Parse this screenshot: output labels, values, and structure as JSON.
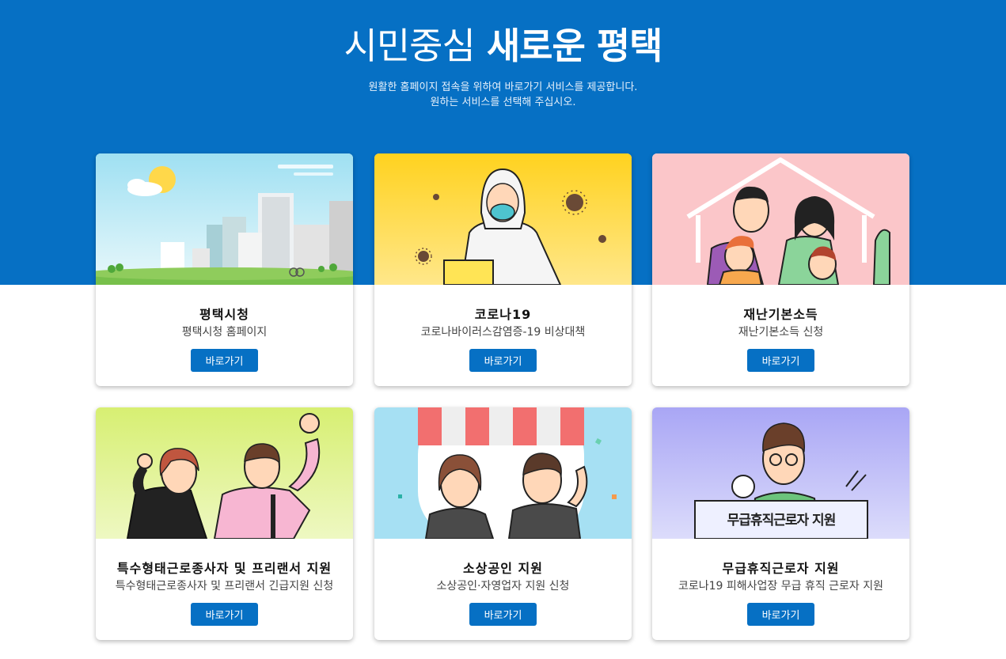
{
  "hero": {
    "title_light": "시민중심",
    "title_bold": "새로운 평택",
    "subtitle_line1": "원활한 홈페이지 접속을 위하여 바로가기 서비스를 제공합니다.",
    "subtitle_line2": "원하는 서비스를 선택해 주십시오."
  },
  "colors": {
    "brand": "#0670c4"
  },
  "cards": [
    {
      "title": "평택시청",
      "desc": "평택시청 홈페이지",
      "button": "바로가기",
      "illustration": "city-skyline-illustration"
    },
    {
      "title": "코로나19",
      "desc": "코로나바이러스감염증-19 비상대책",
      "button": "바로가기",
      "illustration": "protective-suit-worker-illustration"
    },
    {
      "title": "재난기본소득",
      "desc": "재난기본소득 신청",
      "button": "바로가기",
      "illustration": "family-with-masks-illustration"
    },
    {
      "title": "특수형태근로종사자 및 프리랜서 지원",
      "desc": "특수형태근로종사자 및 프리랜서 긴급지원 신청",
      "button": "바로가기",
      "illustration": "cheering-workers-illustration"
    },
    {
      "title": "소상공인 지원",
      "desc": "소상공인·자영업자 지원 신청",
      "button": "바로가기",
      "illustration": "shop-owners-illustration"
    },
    {
      "title": "무급휴직근로자 지원",
      "desc": "코로나19 피해사업장 무급 휴직 근로자 지원",
      "button": "바로가기",
      "illustration": "worker-with-sign-illustration",
      "sign_text": "무급휴직근로자 지원"
    }
  ]
}
